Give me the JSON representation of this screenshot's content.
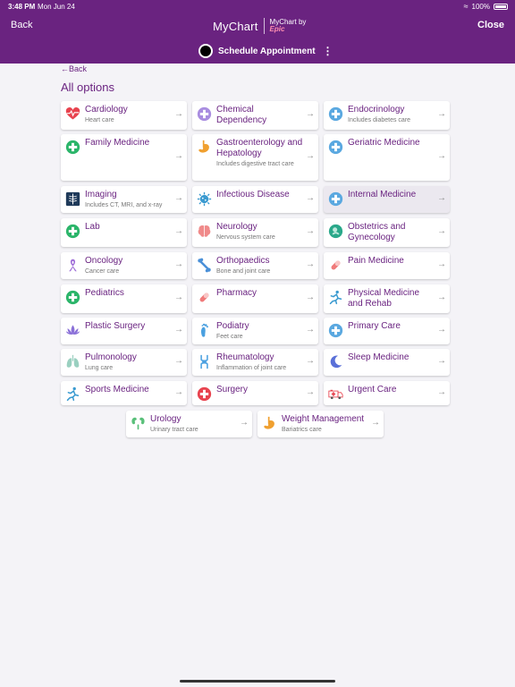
{
  "status": {
    "time": "3:48 PM",
    "date": "Mon Jun 24",
    "battery": "100%"
  },
  "nav": {
    "back": "Back",
    "close": "Close",
    "brand": "MyChart",
    "brand_by": "MyChart by",
    "brand_epic": "Epic"
  },
  "schedule": {
    "title": "Schedule Appointment"
  },
  "page": {
    "back_link": "Back",
    "title": "All options"
  },
  "cards": [
    {
      "name": "Cardiology",
      "sub": "Heart care",
      "icon": "heart-pulse-icon",
      "color": "#e8434f"
    },
    {
      "name": "Chemical Dependency",
      "sub": "",
      "icon": "plus-circle-icon",
      "color": "#a98de0"
    },
    {
      "name": "Endocrinology",
      "sub": "Includes diabetes care",
      "icon": "plus-circle-icon",
      "color": "#5aa8e0"
    },
    {
      "name": "Family Medicine",
      "sub": "",
      "icon": "plus-circle-icon",
      "color": "#2bb56a"
    },
    {
      "name": "Gastroenterology and Hepatology",
      "sub": "Includes digestive tract care",
      "icon": "stomach-icon",
      "color": "#f0a030"
    },
    {
      "name": "Geriatric Medicine",
      "sub": "",
      "icon": "plus-circle-icon",
      "color": "#5aa8e0"
    },
    {
      "name": "Imaging",
      "sub": "Includes CT, MRI, and x-ray",
      "icon": "xray-icon",
      "color": "#1f3a5a"
    },
    {
      "name": "Infectious Disease",
      "sub": "",
      "icon": "virus-icon",
      "color": "#3a9ad0"
    },
    {
      "name": "Internal Medicine",
      "sub": "",
      "icon": "plus-circle-icon",
      "color": "#5aa8e0"
    },
    {
      "name": "Lab",
      "sub": "",
      "icon": "plus-circle-icon",
      "color": "#2bb56a"
    },
    {
      "name": "Neurology",
      "sub": "Nervous system care",
      "icon": "brain-icon",
      "color": "#f08a8a"
    },
    {
      "name": "Obstetrics and Gynecology",
      "sub": "",
      "icon": "baby-icon",
      "color": "#2aa88a"
    },
    {
      "name": "Oncology",
      "sub": "Cancer care",
      "icon": "ribbon-icon",
      "color": "#a070d8"
    },
    {
      "name": "Orthopaedics",
      "sub": "Bone and joint care",
      "icon": "bone-icon",
      "color": "#4a90d8"
    },
    {
      "name": "Pain Medicine",
      "sub": "",
      "icon": "pill-icon",
      "color": "#f07a7a"
    },
    {
      "name": "Pediatrics",
      "sub": "",
      "icon": "plus-circle-icon",
      "color": "#2bb56a"
    },
    {
      "name": "Pharmacy",
      "sub": "",
      "icon": "pill-icon",
      "color": "#f07a7a"
    },
    {
      "name": "Physical Medicine and Rehab",
      "sub": "",
      "icon": "running-person-icon",
      "color": "#3a9ad0"
    },
    {
      "name": "Plastic Surgery",
      "sub": "",
      "icon": "lotus-icon",
      "color": "#8a70d8"
    },
    {
      "name": "Podiatry",
      "sub": "Feet care",
      "icon": "foot-icon",
      "color": "#4aa0e0"
    },
    {
      "name": "Primary Care",
      "sub": "",
      "icon": "plus-circle-icon",
      "color": "#5aa8e0"
    },
    {
      "name": "Pulmonology",
      "sub": "Lung care",
      "icon": "lungs-icon",
      "color": "#9ad0c0"
    },
    {
      "name": "Rheumatology",
      "sub": "Inflammation of joint care",
      "icon": "joint-icon",
      "color": "#4aa0e0"
    },
    {
      "name": "Sleep Medicine",
      "sub": "",
      "icon": "moon-icon",
      "color": "#5a70d8"
    },
    {
      "name": "Sports Medicine",
      "sub": "",
      "icon": "running-person-icon",
      "color": "#3a9ad0"
    },
    {
      "name": "Surgery",
      "sub": "",
      "icon": "plus-circle-icon",
      "color": "#e8434f"
    },
    {
      "name": "Urgent Care",
      "sub": "",
      "icon": "ambulance-icon",
      "color": "#e8434f"
    },
    {
      "name": "Urology",
      "sub": "Urinary tract care",
      "icon": "kidney-icon",
      "color": "#5ac07a"
    },
    {
      "name": "Weight Management",
      "sub": "Bariatrics care",
      "icon": "stomach-icon",
      "color": "#f0a030"
    }
  ],
  "highlighted": "Internal Medicine",
  "accent": "#6a2380"
}
